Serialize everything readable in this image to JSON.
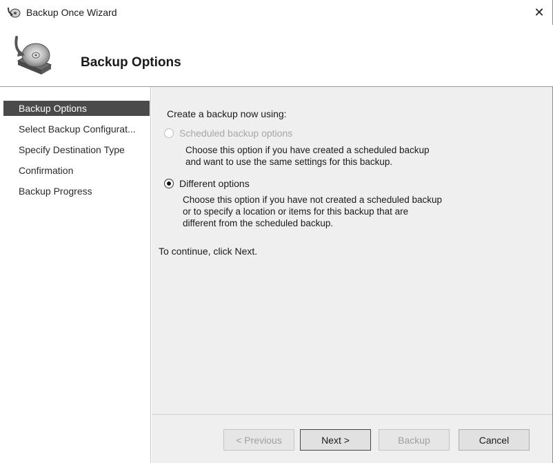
{
  "window": {
    "title": "Backup Once Wizard",
    "close_glyph": "✕"
  },
  "header": {
    "title": "Backup Options",
    "icon": "backup-disk-icon"
  },
  "nav": {
    "items": [
      {
        "label": "Backup Options",
        "active": true
      },
      {
        "label": "Select Backup Configurat...",
        "active": false
      },
      {
        "label": "Specify Destination Type",
        "active": false
      },
      {
        "label": "Confirmation",
        "active": false
      },
      {
        "label": "Backup Progress",
        "active": false
      }
    ]
  },
  "main": {
    "prompt": "Create a backup now using:",
    "options": [
      {
        "label": "Scheduled backup options",
        "description": "Choose this option if you have created a scheduled backup\nand want to use the same settings for this backup.",
        "selected": false,
        "enabled": false
      },
      {
        "label": "Different options",
        "description": "Choose this option if you have not created a scheduled backup\nor to specify a location or items for this backup that are\ndifferent from the scheduled backup.",
        "selected": true,
        "enabled": true
      }
    ],
    "continue_text": "To continue, click Next."
  },
  "buttons": {
    "previous": "< Previous",
    "next": "Next >",
    "backup": "Backup",
    "cancel": "Cancel"
  }
}
